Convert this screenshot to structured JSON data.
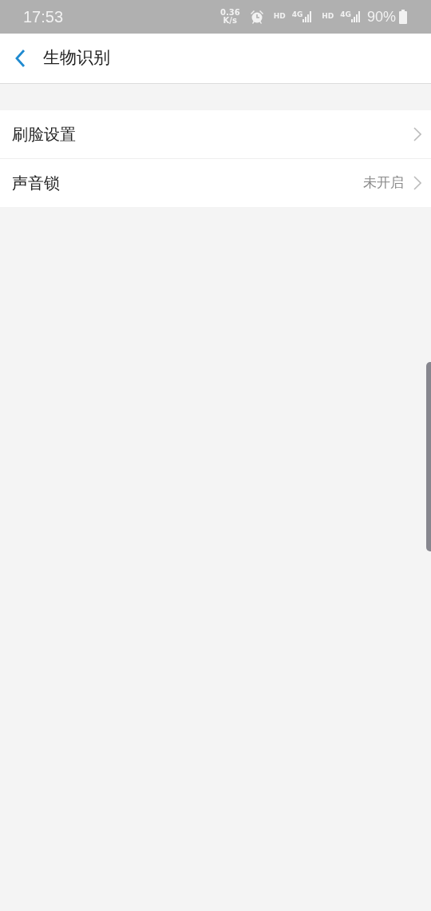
{
  "status_bar": {
    "time": "17:53",
    "net_speed": "0.36",
    "net_unit": "K/s",
    "networks": [
      {
        "hd": "HD",
        "type": "4G"
      },
      {
        "hd": "HD",
        "type": "4G"
      }
    ],
    "battery": "90%"
  },
  "header": {
    "title": "生物识别"
  },
  "items": [
    {
      "label": "刷脸设置"
    },
    {
      "label": "声音锁",
      "value": "未开启"
    }
  ]
}
